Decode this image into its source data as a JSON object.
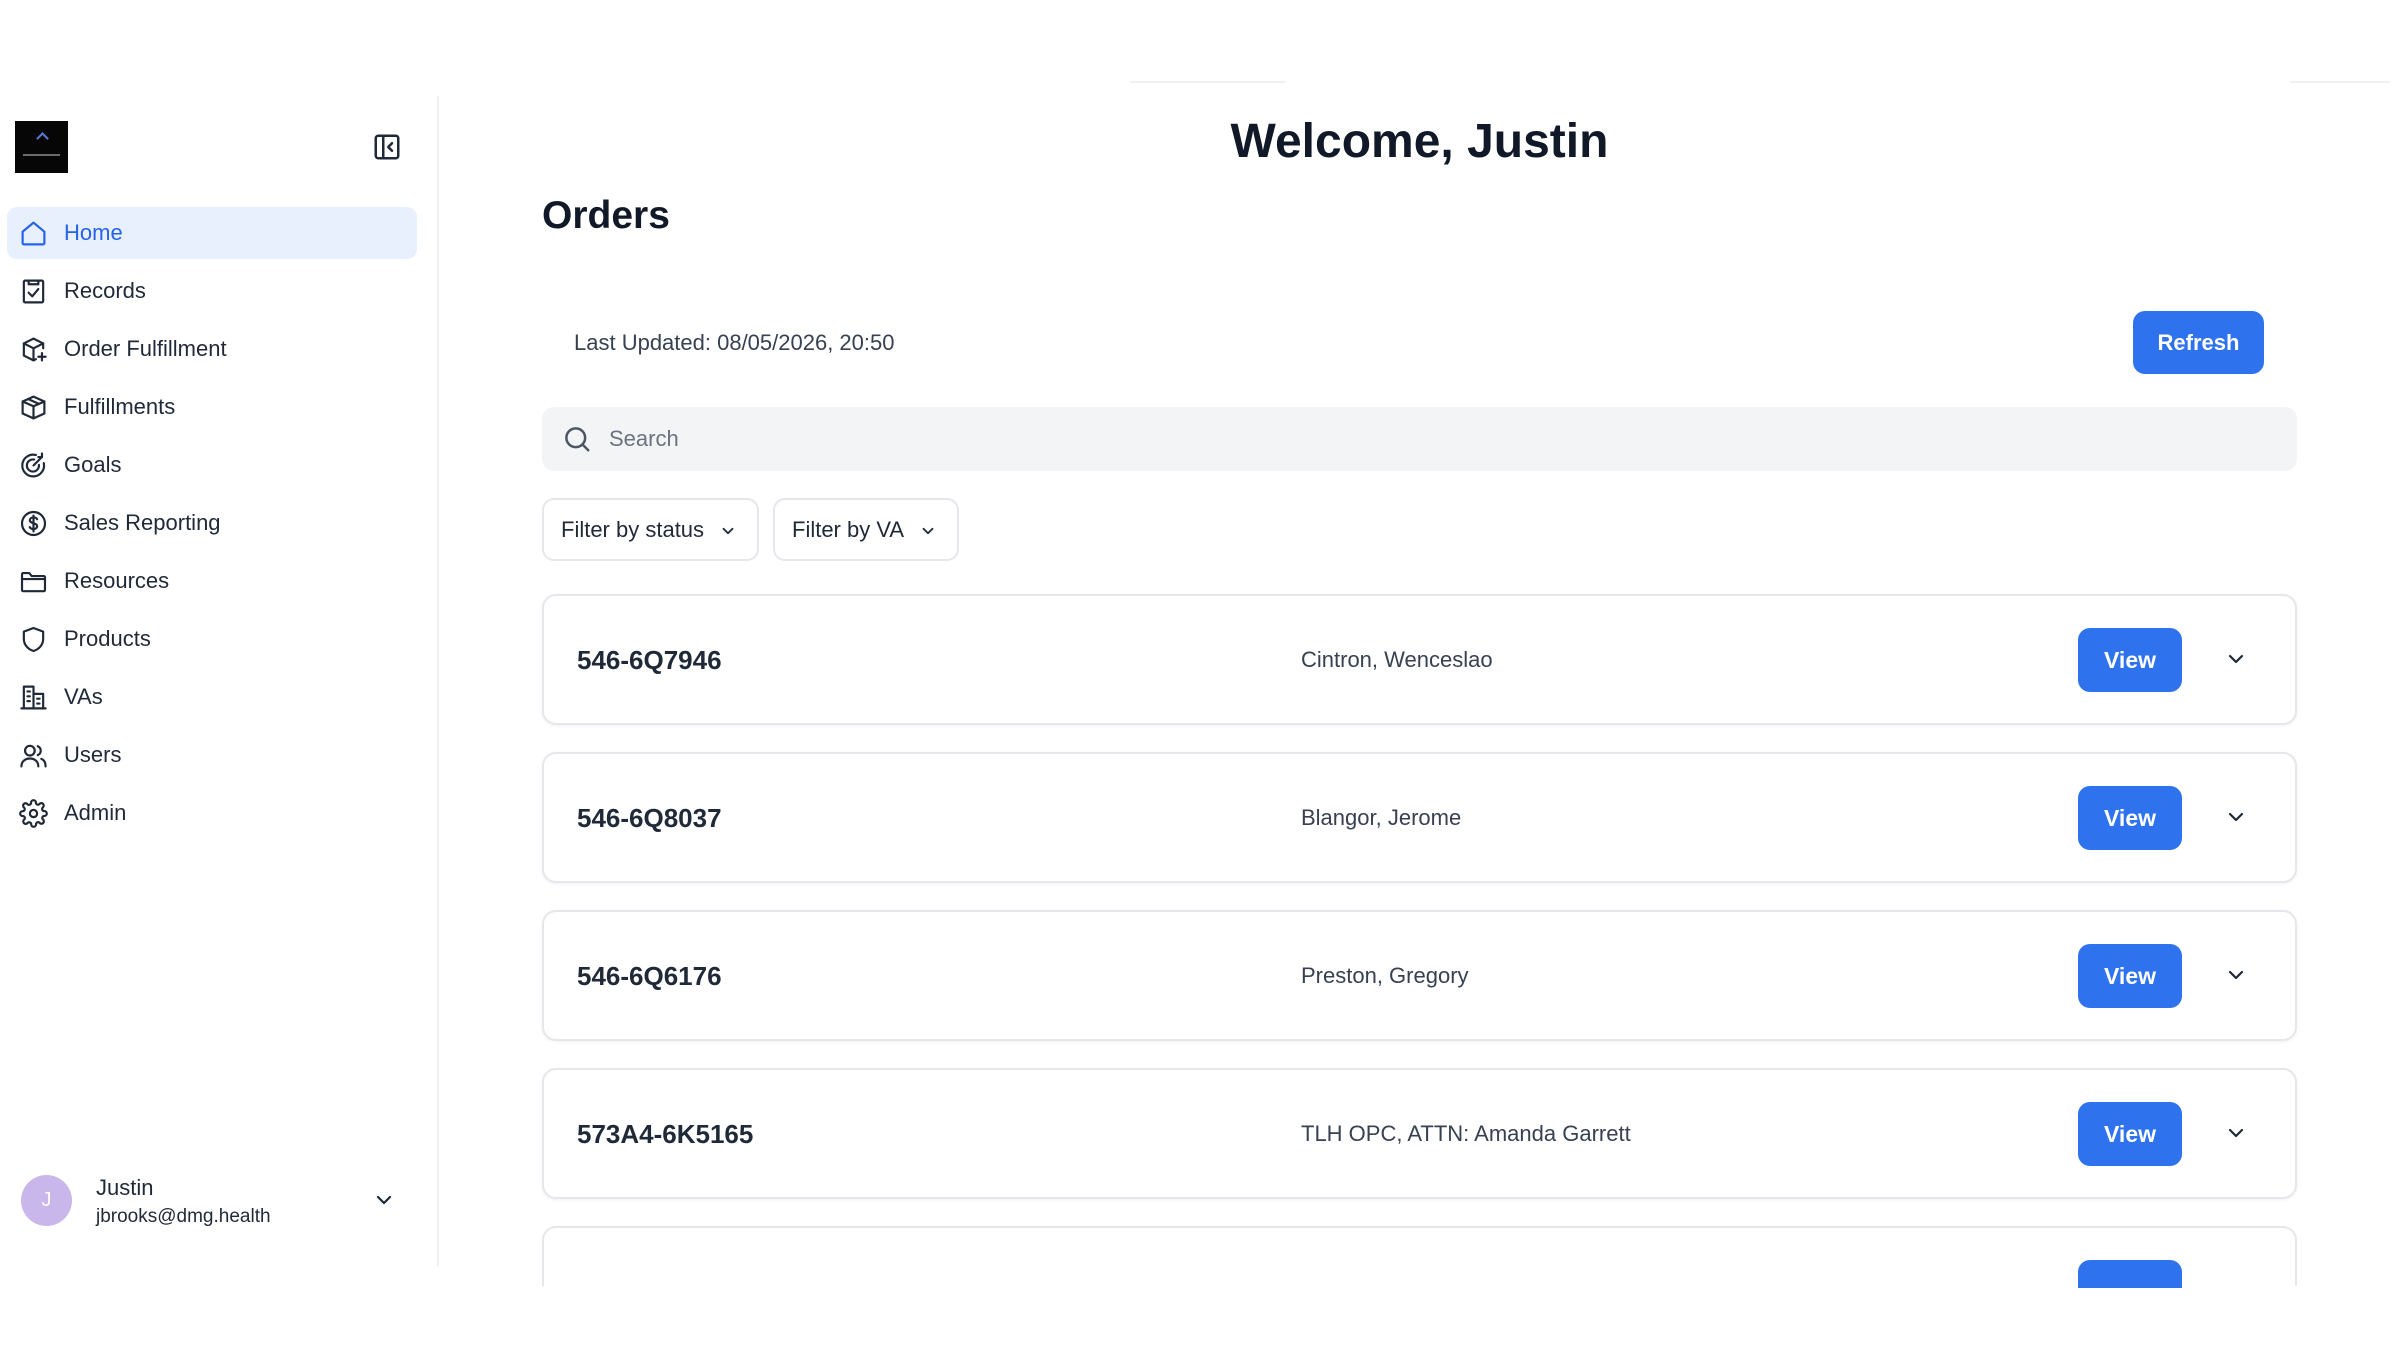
{
  "header": {
    "welcome": "Welcome, Justin"
  },
  "sidebar": {
    "items": [
      {
        "label": "Home",
        "icon": "home-icon",
        "active": true
      },
      {
        "label": "Records",
        "icon": "clipboard-check-icon"
      },
      {
        "label": "Order Fulfillment",
        "icon": "package-plus-icon"
      },
      {
        "label": "Fulfillments",
        "icon": "package-icon"
      },
      {
        "label": "Goals",
        "icon": "target-icon"
      },
      {
        "label": "Sales Reporting",
        "icon": "dollar-circle-icon"
      },
      {
        "label": "Resources",
        "icon": "folder-icon"
      },
      {
        "label": "Products",
        "icon": "shield-icon"
      },
      {
        "label": "VAs",
        "icon": "building-icon"
      },
      {
        "label": "Users",
        "icon": "users-icon"
      },
      {
        "label": "Admin",
        "icon": "gear-icon"
      }
    ],
    "user": {
      "initial": "J",
      "name": "Justin",
      "email": "jbrooks@dmg.health"
    }
  },
  "orders": {
    "title": "Orders",
    "last_updated": "Last Updated: 08/05/2026, 20:50",
    "refresh_label": "Refresh",
    "search_placeholder": "Search",
    "filters": {
      "status": "Filter by status",
      "va": "Filter by VA"
    },
    "view_label": "View",
    "rows": [
      {
        "id": "546-6Q7946",
        "customer": "Cintron, Wenceslao"
      },
      {
        "id": "546-6Q8037",
        "customer": "Blangor, Jerome"
      },
      {
        "id": "546-6Q6176",
        "customer": "Preston, Gregory"
      },
      {
        "id": "573A4-6K5165",
        "customer": "TLH OPC, ATTN: Amanda Garrett"
      }
    ]
  },
  "colors": {
    "accent": "#2f72ee",
    "active_nav_bg": "#e8effd",
    "avatar": "#c9b6ea"
  }
}
